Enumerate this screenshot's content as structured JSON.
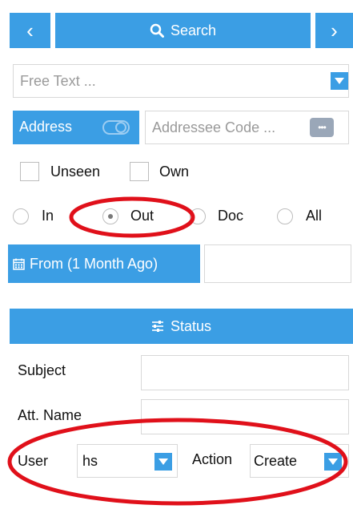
{
  "toolbar": {
    "prev_label": "‹",
    "search_label": "Search",
    "next_label": "›"
  },
  "free_text": {
    "placeholder": "Free Text ..."
  },
  "address": {
    "label": "Address",
    "code_placeholder": "Addressee Code ...",
    "more_label": "•••"
  },
  "filters": {
    "unseen_label": "Unseen",
    "own_label": "Own"
  },
  "direction": {
    "options": [
      "In",
      "Out",
      "Doc",
      "All"
    ],
    "selected": "Out"
  },
  "date": {
    "from_label": "From (1 Month Ago)"
  },
  "status": {
    "label": "Status"
  },
  "form": {
    "subject_label": "Subject",
    "att_name_label": "Att. Name",
    "user_label": "User",
    "user_value": "hs",
    "action_label": "Action",
    "action_value": "Create"
  },
  "colors": {
    "accent": "#3b9ee4",
    "highlight": "#e0101a"
  }
}
